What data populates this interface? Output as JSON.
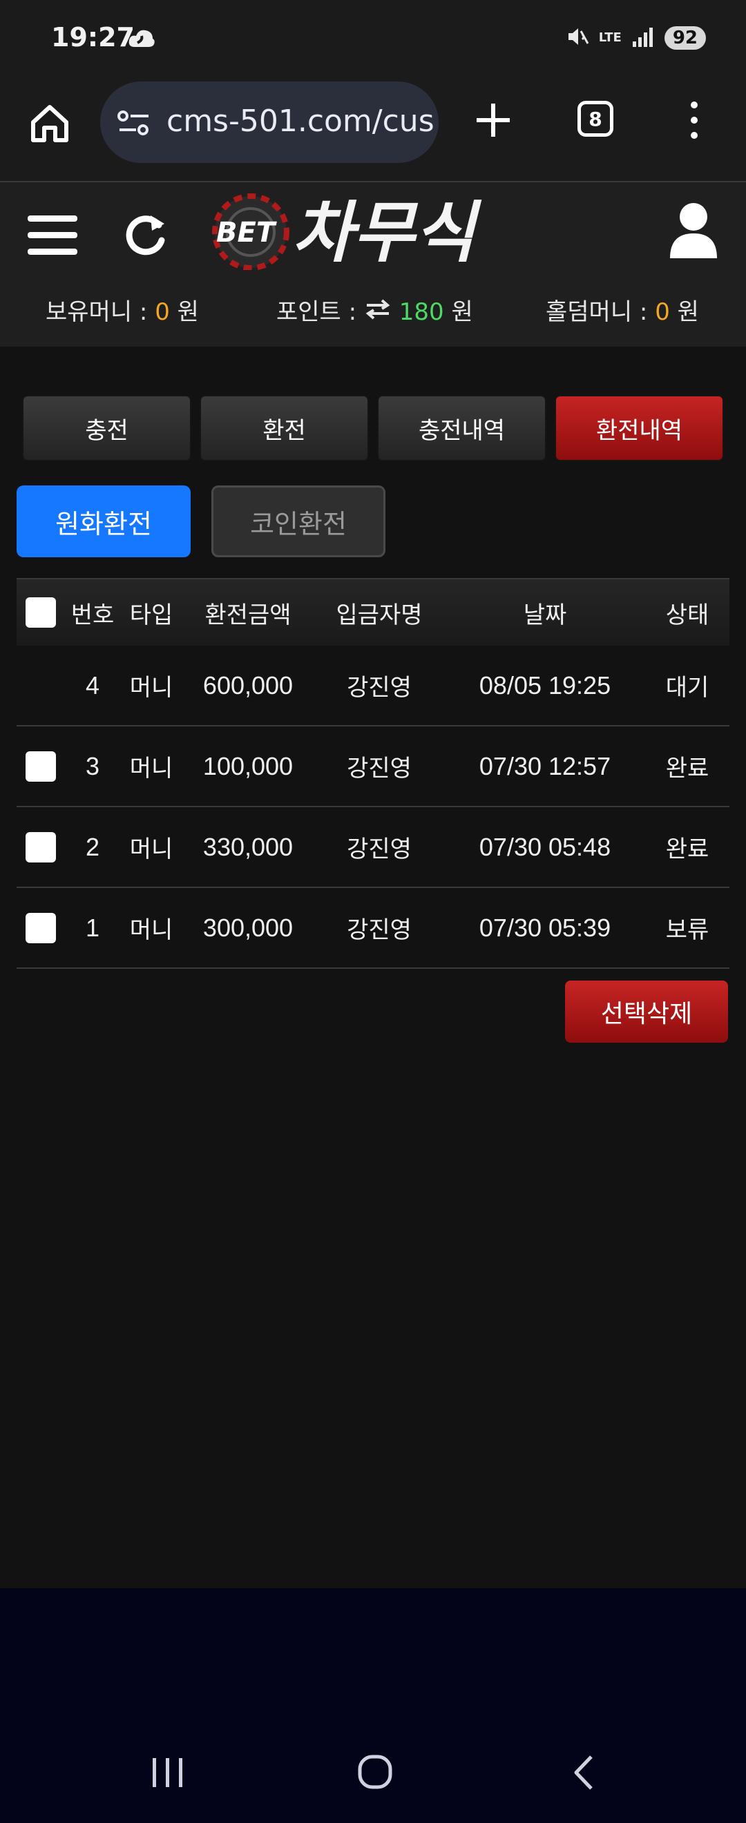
{
  "status_bar": {
    "time": "19:27",
    "network": "LTE",
    "battery": "92"
  },
  "browser": {
    "url": "cms-501.com/cus",
    "tab_count": "8"
  },
  "header": {
    "logo_bet": "BET",
    "logo_name": "차무식",
    "balances": [
      {
        "label": "보유머니 : ",
        "value": "0",
        "unit": " 원"
      },
      {
        "label": "포인트 : ",
        "value": "180",
        "unit": " 원"
      },
      {
        "label": "홀덤머니 : ",
        "value": "0",
        "unit": " 원"
      }
    ]
  },
  "tabs": [
    {
      "label": "충전",
      "active": false
    },
    {
      "label": "환전",
      "active": false
    },
    {
      "label": "충전내역",
      "active": false
    },
    {
      "label": "환전내역",
      "active": true
    }
  ],
  "subtabs": [
    {
      "label": "원화환전",
      "active": true
    },
    {
      "label": "코인환전",
      "active": false
    }
  ],
  "table": {
    "columns": [
      "번호",
      "타입",
      "환전금액",
      "입금자명",
      "날짜",
      "상태"
    ],
    "rows": [
      {
        "no": "4",
        "type": "머니",
        "amount": "600,000",
        "name": "강진영",
        "date": "08/05 19:25",
        "status": "대기",
        "checkbox": false
      },
      {
        "no": "3",
        "type": "머니",
        "amount": "100,000",
        "name": "강진영",
        "date": "07/30 12:57",
        "status": "완료",
        "checkbox": true
      },
      {
        "no": "2",
        "type": "머니",
        "amount": "330,000",
        "name": "강진영",
        "date": "07/30 05:48",
        "status": "완료",
        "checkbox": true
      },
      {
        "no": "1",
        "type": "머니",
        "amount": "300,000",
        "name": "강진영",
        "date": "07/30 05:39",
        "status": "보류",
        "checkbox": true
      }
    ]
  },
  "delete_button": "선택삭제",
  "colors": {
    "accent_red": "#b01a1a",
    "accent_blue": "#1677ff",
    "money_orange": "#f5a623",
    "point_green": "#4cd964"
  }
}
